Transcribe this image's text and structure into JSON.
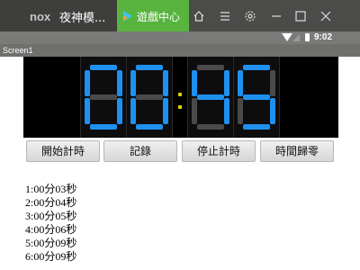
{
  "window": {
    "logo": "nox",
    "app_tab_title": "夜神模...",
    "center_tab_label": "遊戲中心",
    "icons": [
      "home-icon",
      "menu-icon",
      "gear-icon",
      "minimize-icon",
      "maximize-icon",
      "close-icon"
    ]
  },
  "status_bar": {
    "time": "9:02",
    "icons": [
      "wifi-icon",
      "signal-icon",
      "battery-icon"
    ]
  },
  "app": {
    "title": "Screen1",
    "clock": {
      "display": "00:45",
      "digits": [
        "0",
        "0",
        "4",
        "5"
      ],
      "digit_color": "#1e90f0",
      "inactive_segment_color": "#4a4a4a",
      "colon_color": "#e5d400"
    },
    "buttons": {
      "start": "開始計時",
      "record": "記錄",
      "stop": "停止計時",
      "reset": "時間歸零"
    },
    "log": [
      "1:00分03秒",
      "2:00分04秒",
      "3:00分05秒",
      "4:00分06秒",
      "5:00分09秒",
      "6:00分09秒"
    ]
  }
}
